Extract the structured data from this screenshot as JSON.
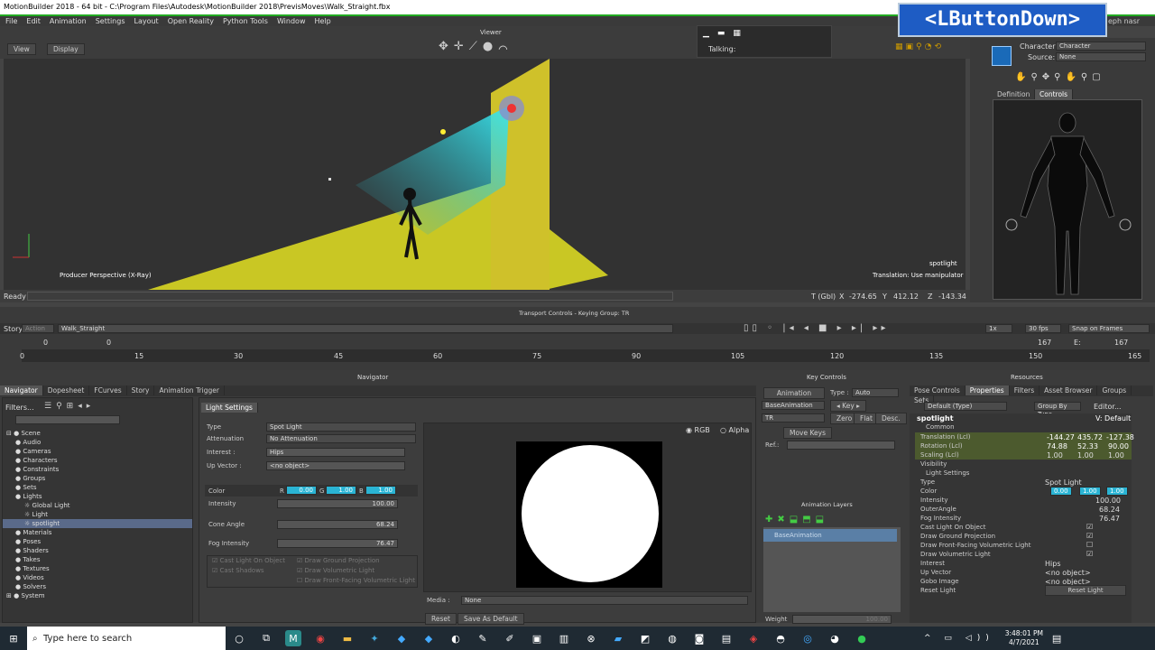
{
  "title": "MotionBuilder 2018 - 64 bit - C:\\Program Files\\Autodesk\\MotionBuilder 2018\\PrevisMoves\\Walk_Straight.fbx",
  "menu": [
    "File",
    "Edit",
    "Animation",
    "Settings",
    "Layout",
    "Open Reality",
    "Python Tools",
    "Window",
    "Help"
  ],
  "recording_label": "<LButtonDown>",
  "user_name": "eph nasr",
  "viewer_label": "Viewer",
  "view_btn": "View",
  "display_btn": "Display",
  "talking": "Talking:",
  "viewport": {
    "camera_label": "Producer Perspective (X-Ray)",
    "selected": "spotlight",
    "hint": "Translation: Use manipulator"
  },
  "status": {
    "ready": "Ready",
    "tgbl": "T (Gbl)",
    "x_label": "X",
    "x": "-274.65",
    "y_label": "Y",
    "y": "412.12",
    "z_label": "Z",
    "z": "-143.34"
  },
  "character": {
    "char_label": "Character:",
    "char_value": "Character",
    "source_label": "Source:",
    "source_value": "None",
    "tab_definition": "Definition",
    "tab_controls": "Controls"
  },
  "transport": {
    "title": "Transport Controls  -  Keying Group: TR",
    "story": "Story",
    "action": "Action",
    "take": "Walk_Straight",
    "speed": "1x",
    "fps": "30 fps",
    "snap": "Snap on Frames",
    "start": "0",
    "cur": "0",
    "end": "167",
    "end2": "167",
    "e": "E:",
    "ticks": [
      "0",
      "15",
      "30",
      "45",
      "60",
      "75",
      "90",
      "105",
      "120",
      "135",
      "150",
      "165"
    ]
  },
  "navigator": {
    "title": "Navigator",
    "tabs": [
      "Navigator",
      "Dopesheet",
      "FCurves",
      "Story",
      "Animation Trigger"
    ],
    "filters": "Filters...",
    "tree": [
      "Scene",
      "Audio",
      "Cameras",
      "Characters",
      "Constraints",
      "Groups",
      "Sets",
      "Lights",
      "Global Light",
      "Light",
      "spotlight",
      "Materials",
      "Poses",
      "Shaders",
      "Takes",
      "Textures",
      "Videos",
      "Solvers",
      "System"
    ],
    "light_settings": "Light Settings",
    "type_label": "Type",
    "type_value": "Spot Light",
    "atten_label": "Attenuation",
    "atten_value": "No Attenuation",
    "interest_label": "Interest :",
    "interest_value": "Hips",
    "upvec_label": "Up Vector :",
    "upvec_value": "<no object>",
    "color_label": "Color",
    "r_label": "R",
    "r": "0.00",
    "g_label": "G",
    "g": "1.00",
    "b_label": "B",
    "b": "1.00",
    "intensity_label": "Intensity",
    "intensity": "100.00",
    "cone_label": "Cone Angle",
    "cone": "68.24",
    "fog_label": "Fog Intensity",
    "fog": "76.47",
    "checks": [
      "Cast Light On Object",
      "Cast Shadows",
      "Draw Ground Projection",
      "Draw Volumetric Light",
      "Draw Front-Facing Volumetric Light"
    ],
    "rgb": "RGB",
    "alpha": "Alpha",
    "media_label": "Media :",
    "media_value": "None",
    "reset": "Reset",
    "save_default": "Save As Default"
  },
  "keycontrols": {
    "title": "Key Controls",
    "animation": "Animation",
    "type_label": "Type :",
    "type_value": "Auto",
    "base": "BaseAnimation",
    "key": "Key",
    "tr": "TR",
    "zero": "Zero",
    "flat": "Flat",
    "desc": "Desc.",
    "move_keys": "Move Keys",
    "ref": "Ref.:",
    "layers_title": "Animation Layers",
    "layer": "BaseAnimation",
    "weight": "Weight",
    "weight_value": "100.00"
  },
  "resources": {
    "title": "Resources",
    "tabs": [
      "Pose Controls",
      "Properties",
      "Filters",
      "Asset Browser",
      "Groups",
      "Sets"
    ],
    "default_type": "Default (Type)",
    "group_by": "Group By Type",
    "editor": "Editor...",
    "object": "spotlight",
    "v_default": "V: Default",
    "common": "Common",
    "rows": [
      {
        "n": "Translation (Lcl)",
        "v": [
          "-144.27",
          "435.72",
          "-127.38"
        ]
      },
      {
        "n": "Rotation (Lcl)",
        "v": [
          "74.88",
          "52.33",
          "90.00"
        ]
      },
      {
        "n": "Scaling (Lcl)",
        "v": [
          "1.00",
          "1.00",
          "1.00"
        ]
      }
    ],
    "visibility": "Visibility",
    "light_settings": "Light Settings",
    "props": [
      {
        "n": "Type",
        "v": "Spot Light"
      },
      {
        "n": "Color",
        "v": ""
      },
      {
        "n": "Intensity",
        "v": "100.00"
      },
      {
        "n": "OuterAngle",
        "v": "68.24"
      },
      {
        "n": "Fog Intensity",
        "v": "76.47"
      },
      {
        "n": "Cast Light On Object",
        "v": ""
      },
      {
        "n": "Draw Ground Projection",
        "v": ""
      },
      {
        "n": "Draw Front-Facing Volumetric Light",
        "v": ""
      },
      {
        "n": "Draw Volumetric Light",
        "v": ""
      },
      {
        "n": "Interest",
        "v": "Hips"
      },
      {
        "n": "Up Vector",
        "v": "<no object>"
      },
      {
        "n": "Gobo Image",
        "v": "<no object>"
      },
      {
        "n": "Reset Light",
        "v": "Reset Light"
      }
    ],
    "color_vals": [
      "0.00",
      "1.00",
      "1.00"
    ]
  },
  "taskbar": {
    "search": "Type here to search",
    "time": "3:48:01 PM",
    "date": "4/7/2021"
  }
}
